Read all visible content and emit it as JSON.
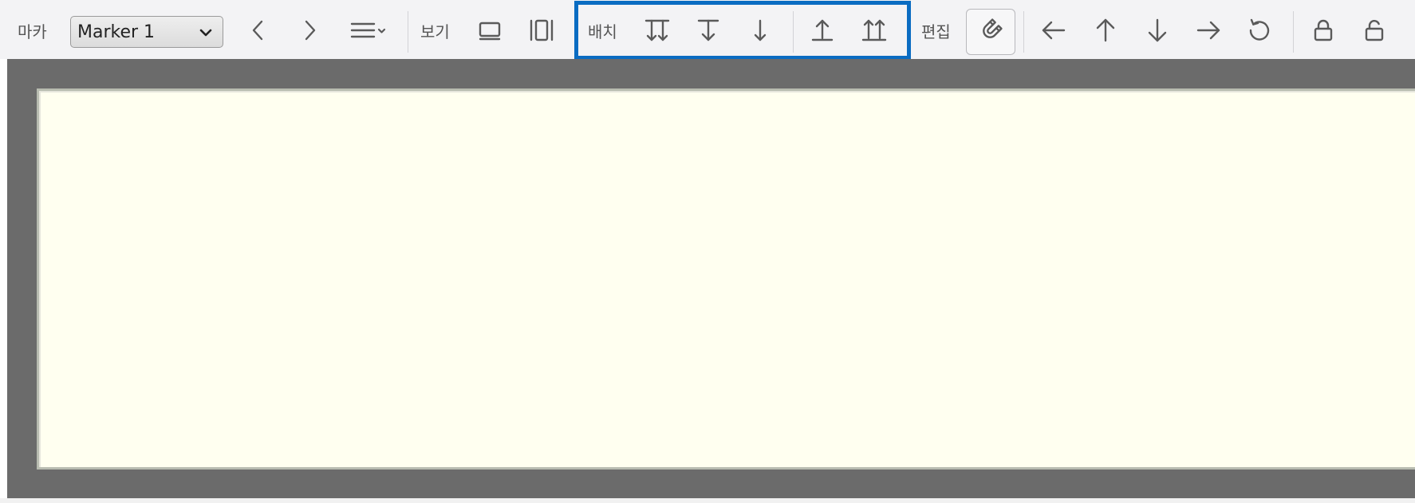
{
  "toolbar": {
    "marker_label": "마카",
    "marker_select": {
      "value": "Marker 1"
    },
    "view_label": "보기",
    "arrange_label": "배치",
    "edit_label": "편집"
  },
  "icons": {
    "prev": "chevron-left-icon",
    "next": "chevron-right-icon",
    "menu": "hamburger-menu-icon",
    "view_single": "single-page-view-icon",
    "view_columns": "column-view-icon",
    "send_to_back": "send-to-back-icon",
    "send_backward": "send-backward-icon",
    "move_down": "move-down-icon",
    "bring_forward": "bring-forward-icon",
    "bring_to_front": "bring-to-front-icon",
    "magnet": "magnet-snap-icon",
    "arrow_left": "arrow-left-icon",
    "arrow_up": "arrow-up-icon",
    "arrow_down": "arrow-down-icon",
    "arrow_right": "arrow-right-icon",
    "rotate": "rotate-icon",
    "lock": "lock-icon",
    "unlock": "unlock-icon"
  },
  "colors": {
    "toolbar_bg": "#f3f3f5",
    "highlight": "#0a6cc2",
    "canvas_bg": "#6b6b6b",
    "page_bg": "#fffff0"
  }
}
